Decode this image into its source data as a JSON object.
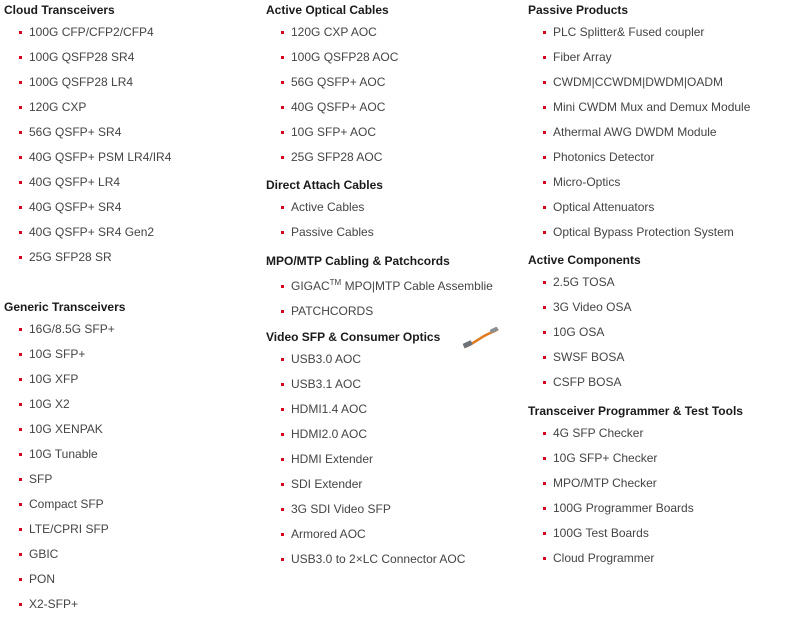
{
  "columns": [
    {
      "sections": [
        {
          "title": "Cloud Transceivers",
          "items": [
            "100G CFP/CFP2/CFP4",
            "100G QSFP28 SR4",
            "100G QSFP28 LR4",
            "120G CXP",
            "56G QSFP+ SR4",
            "40G QSFP+ PSM LR4/IR4",
            "40G QSFP+ LR4",
            "40G QSFP+ SR4",
            "40G QSFP+ SR4 Gen2",
            "25G SFP28 SR"
          ]
        },
        {
          "title": "Generic Transceivers",
          "items": [
            "16G/8.5G SFP+",
            "10G SFP+",
            "10G XFP",
            "10G X2",
            "10G XENPAK",
            "10G Tunable",
            "SFP",
            "Compact SFP",
            "LTE/CPRI SFP",
            "GBIC",
            "PON",
            "X2-SFP+"
          ]
        }
      ]
    },
    {
      "sections": [
        {
          "title": "Active Optical Cables",
          "items": [
            "120G CXP AOC",
            "100G QSFP28 AOC",
            "56G QSFP+ AOC",
            "40G QSFP+ AOC",
            "10G SFP+ AOC",
            "25G SFP28 AOC"
          ]
        },
        {
          "title": "Direct Attach Cables",
          "items": [
            "Active Cables",
            "Passive Cables"
          ]
        },
        {
          "title": "MPO/MTP Cabling & Patchcords",
          "items": [
            "GIGAC",
            "PATCHCORDS"
          ],
          "gigac_tm": "TM",
          "gigac_rest": " MPO|MTP Cable Assemblie"
        },
        {
          "title": "Video SFP & Consumer Optics",
          "icon": "usb-cable-icon",
          "items": [
            "USB3.0 AOC",
            "USB3.1 AOC",
            "HDMI1.4 AOC",
            "HDMI2.0 AOC",
            "HDMI Extender",
            "SDI Extender",
            "3G SDI Video SFP",
            "Armored AOC",
            "USB3.0 to 2×LC Connector AOC"
          ]
        }
      ]
    },
    {
      "sections": [
        {
          "title": "Passive Products",
          "items": [
            "PLC Splitter& Fused coupler",
            "Fiber Array",
            "CWDM|CCWDM|DWDM|OADM",
            "Mini CWDM Mux and Demux Module",
            "Athermal AWG DWDM Module",
            "Photonics Detector",
            "Micro-Optics",
            "Optical Attenuators",
            "Optical Bypass Protection System"
          ]
        },
        {
          "title": "Active Components",
          "items": [
            "2.5G TOSA",
            "3G Video OSA",
            "10G OSA",
            "SWSF BOSA",
            "CSFP BOSA"
          ]
        },
        {
          "title": "Transceiver Programmer & Test Tools",
          "items": [
            "4G SFP Checker",
            "10G SFP+ Checker",
            "MPO/MTP Checker",
            "100G Programmer Boards",
            "100G Test Boards",
            "Cloud Programmer"
          ]
        }
      ]
    }
  ],
  "colors": {
    "bullet": "#d6001c",
    "heading": "#1a1a1a",
    "item_text": "#444444"
  }
}
